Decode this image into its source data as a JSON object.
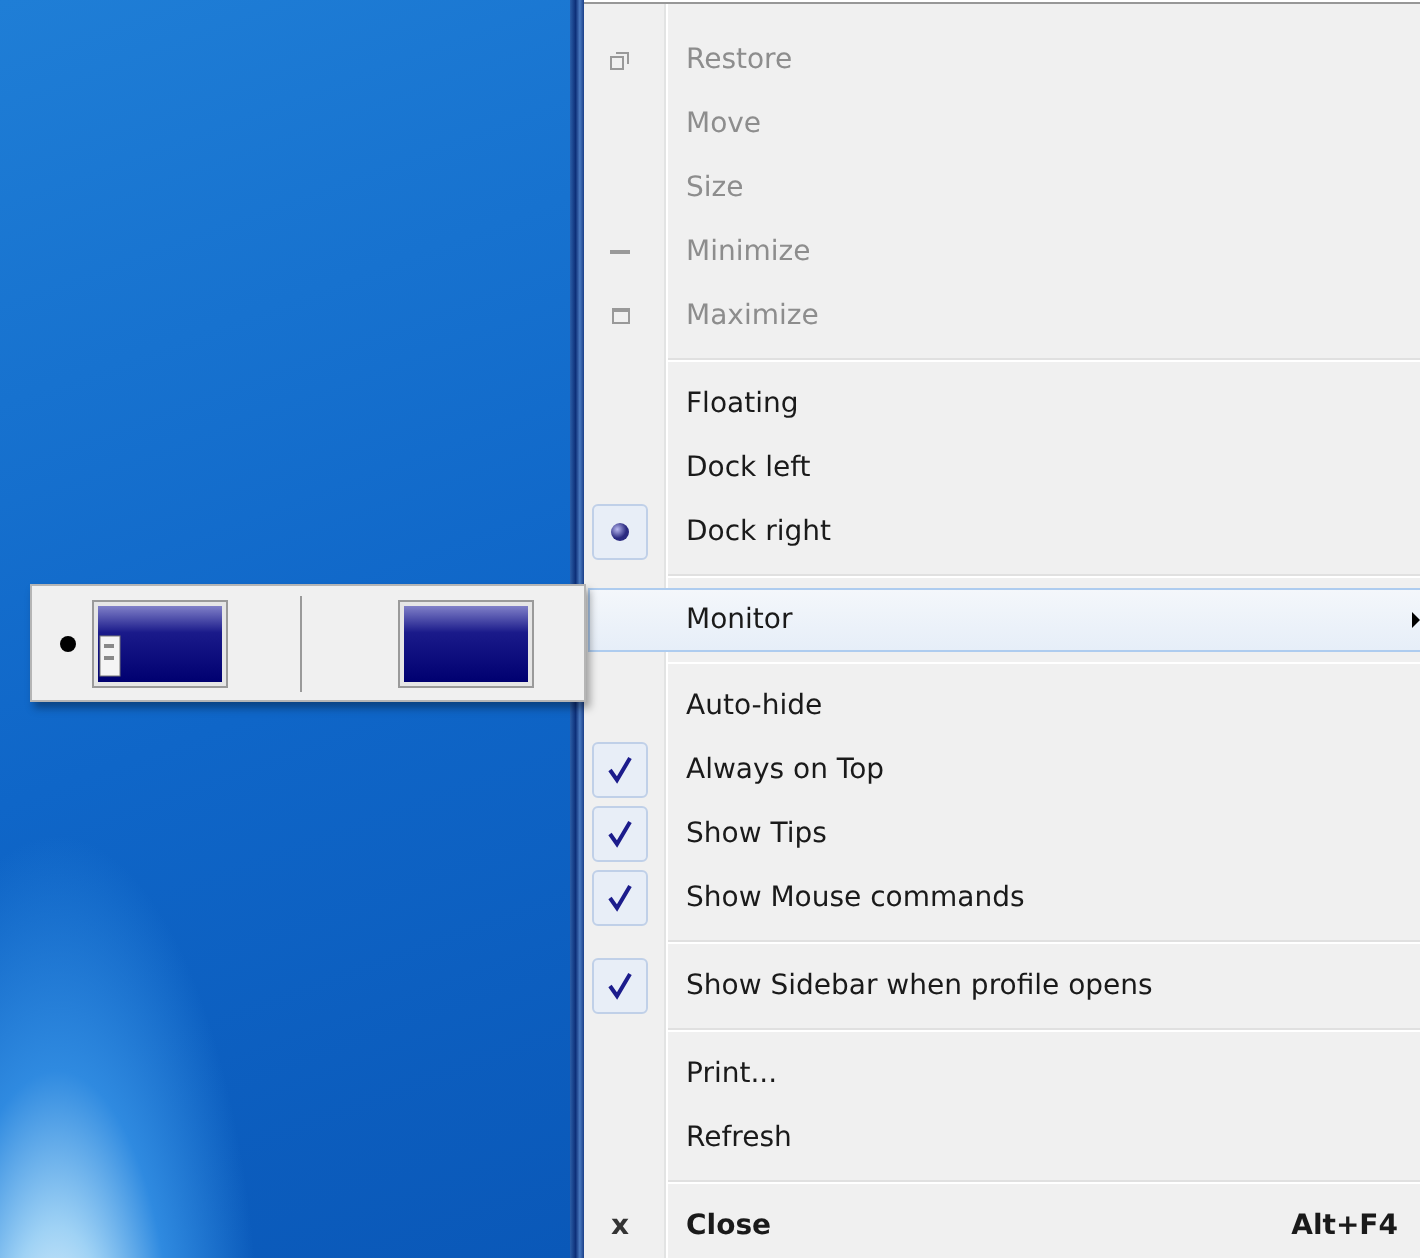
{
  "monitor_picker": {
    "monitors": [
      {
        "selected": true,
        "has_window": true
      },
      {
        "selected": false,
        "has_window": false
      }
    ]
  },
  "menu": {
    "groups": [
      {
        "items": [
          {
            "kind": "command",
            "label": "Restore",
            "disabled": true,
            "highlighted": false
          },
          {
            "kind": "command",
            "label": "Move",
            "disabled": true,
            "highlighted": false
          },
          {
            "kind": "command",
            "label": "Size",
            "disabled": true,
            "highlighted": false
          },
          {
            "kind": "command",
            "label": "Minimize",
            "disabled": true,
            "highlighted": false
          },
          {
            "kind": "command",
            "label": "Maximize",
            "disabled": true,
            "highlighted": false
          }
        ]
      },
      {
        "items": [
          {
            "kind": "radio",
            "label": "Floating",
            "selected": false,
            "disabled": false,
            "highlighted": false
          },
          {
            "kind": "radio",
            "label": "Dock left",
            "selected": false,
            "disabled": false,
            "highlighted": false
          },
          {
            "kind": "radio",
            "label": "Dock right",
            "selected": true,
            "disabled": false,
            "highlighted": false
          }
        ]
      },
      {
        "items": [
          {
            "kind": "submenu",
            "label": "Monitor",
            "disabled": false,
            "highlighted": true
          }
        ]
      },
      {
        "items": [
          {
            "kind": "check",
            "label": "Auto-hide",
            "checked": false,
            "disabled": false,
            "highlighted": false
          },
          {
            "kind": "check",
            "label": "Always on Top",
            "checked": true,
            "disabled": false,
            "highlighted": false
          },
          {
            "kind": "check",
            "label": "Show Tips",
            "checked": true,
            "disabled": false,
            "highlighted": false
          },
          {
            "kind": "check",
            "label": "Show Mouse commands",
            "checked": true,
            "disabled": false,
            "highlighted": false
          }
        ]
      },
      {
        "items": [
          {
            "kind": "check",
            "label": "Show Sidebar when profile opens",
            "checked": true,
            "disabled": false,
            "highlighted": false
          }
        ]
      },
      {
        "items": [
          {
            "kind": "command",
            "label": "Print...",
            "disabled": false,
            "highlighted": false
          },
          {
            "kind": "command",
            "label": "Refresh",
            "disabled": false,
            "highlighted": false
          }
        ]
      },
      {
        "items": [
          {
            "kind": "command",
            "label": "Close",
            "glyph": "x",
            "shortcut": "Alt+F4",
            "bold": true,
            "disabled": false,
            "highlighted": false
          }
        ]
      }
    ]
  }
}
